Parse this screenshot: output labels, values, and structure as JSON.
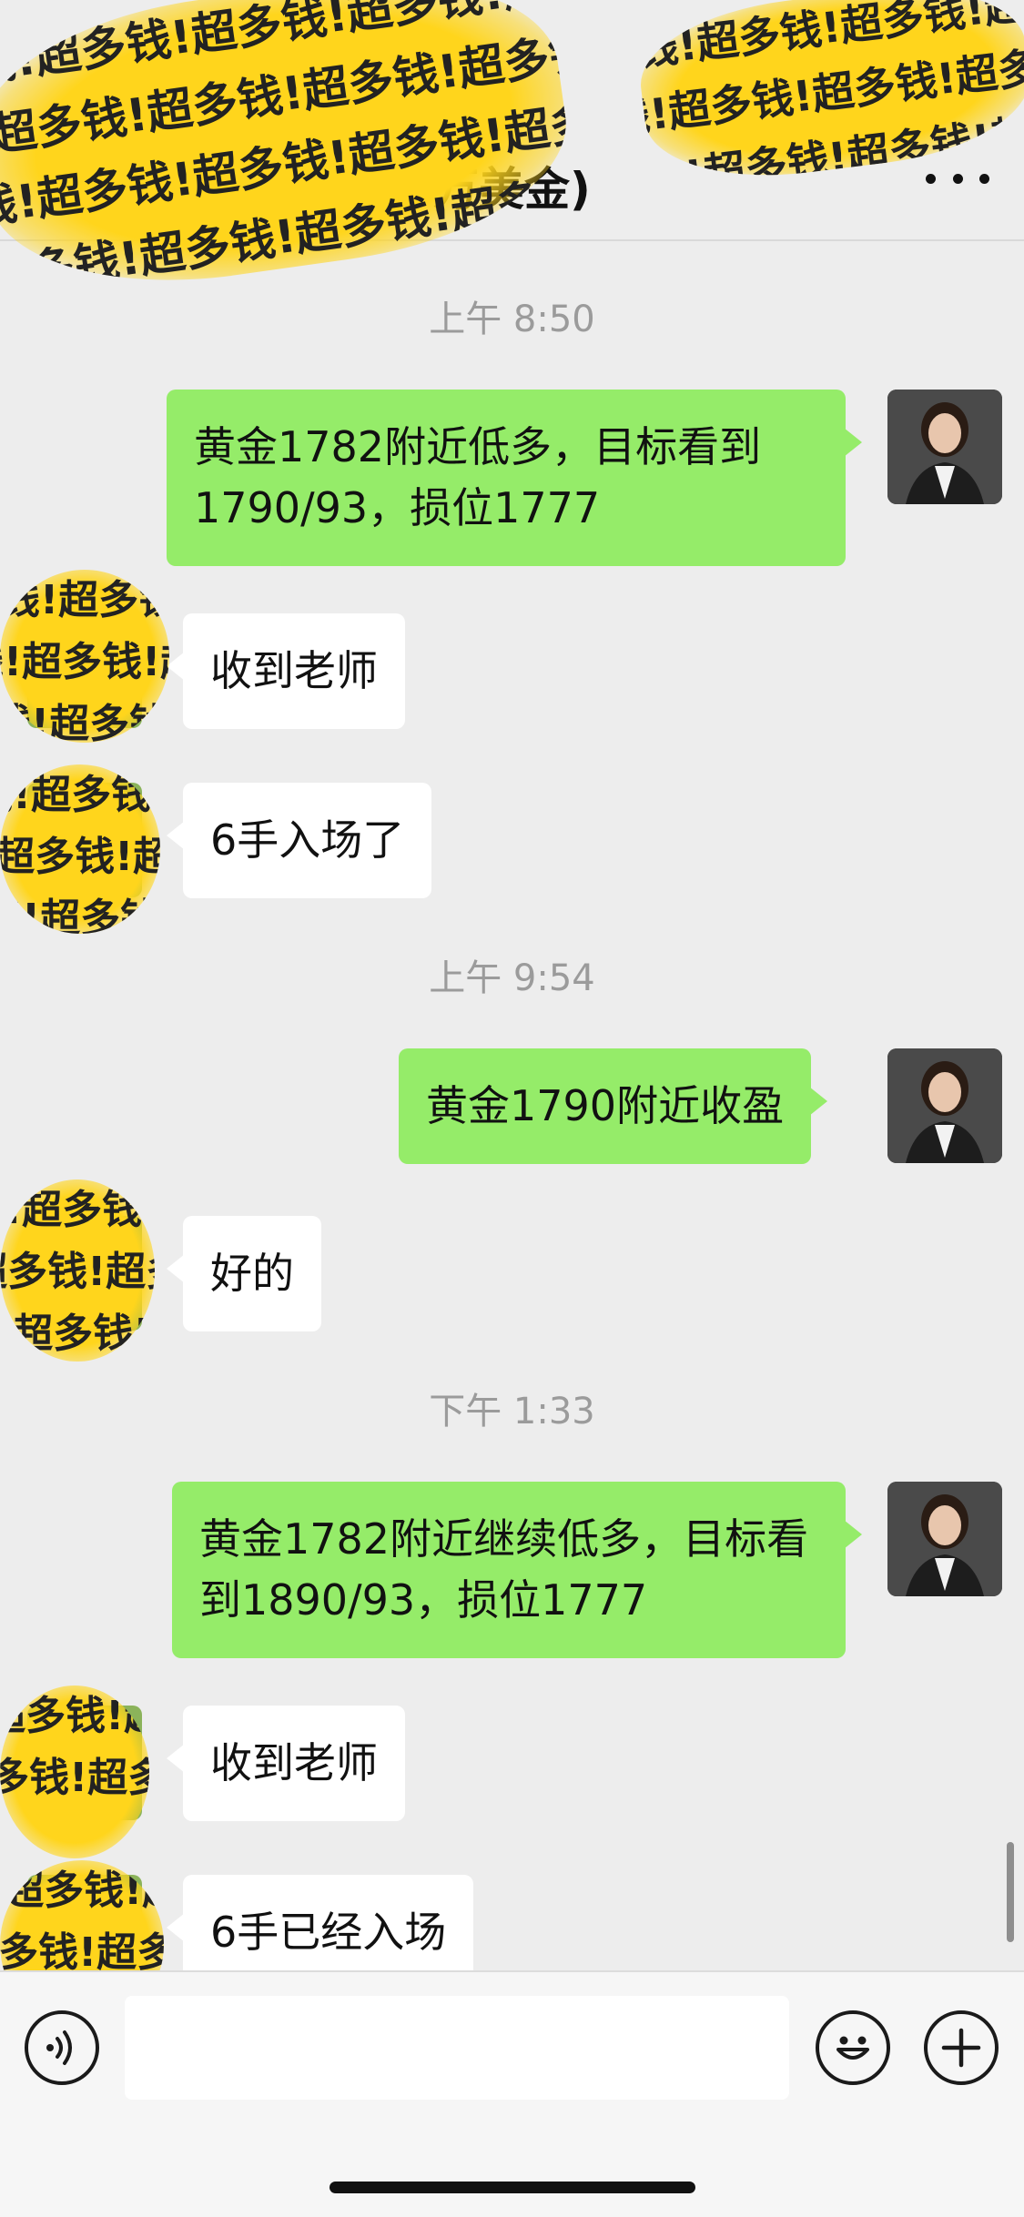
{
  "header": {
    "title": "万美金)",
    "more_icon": "more-dots-icon"
  },
  "sticker": {
    "text": "钱!超多钱!超多钱!超多钱!超多钱!超多钱!超多钱!超多钱!超多"
  },
  "messages": [
    {
      "type": "time",
      "text": "上午 8:50"
    },
    {
      "type": "me",
      "text": "黄金1782附近低多，目标看到1790/93，损位1777"
    },
    {
      "type": "them",
      "text": "收到老师"
    },
    {
      "type": "them",
      "text": "6手入场了"
    },
    {
      "type": "time",
      "text": "上午 9:54"
    },
    {
      "type": "me",
      "text": "黄金1790附近收盈"
    },
    {
      "type": "them",
      "text": "好的"
    },
    {
      "type": "time",
      "text": "下午 1:33"
    },
    {
      "type": "me",
      "text": "黄金1782附近继续低多，目标看到1890/93，损位1777"
    },
    {
      "type": "them",
      "text": "收到老师"
    },
    {
      "type": "them",
      "text": "6手已经入场"
    }
  ],
  "input_bar": {
    "input_value": "",
    "voice_icon": "voice-icon",
    "emoji_icon": "emoji-icon",
    "plus_icon": "plus-icon"
  },
  "colors": {
    "sent_bubble": "#95ec69",
    "received_bubble": "#ffffff",
    "background": "#ededed",
    "sticker": "#ffd51c"
  }
}
